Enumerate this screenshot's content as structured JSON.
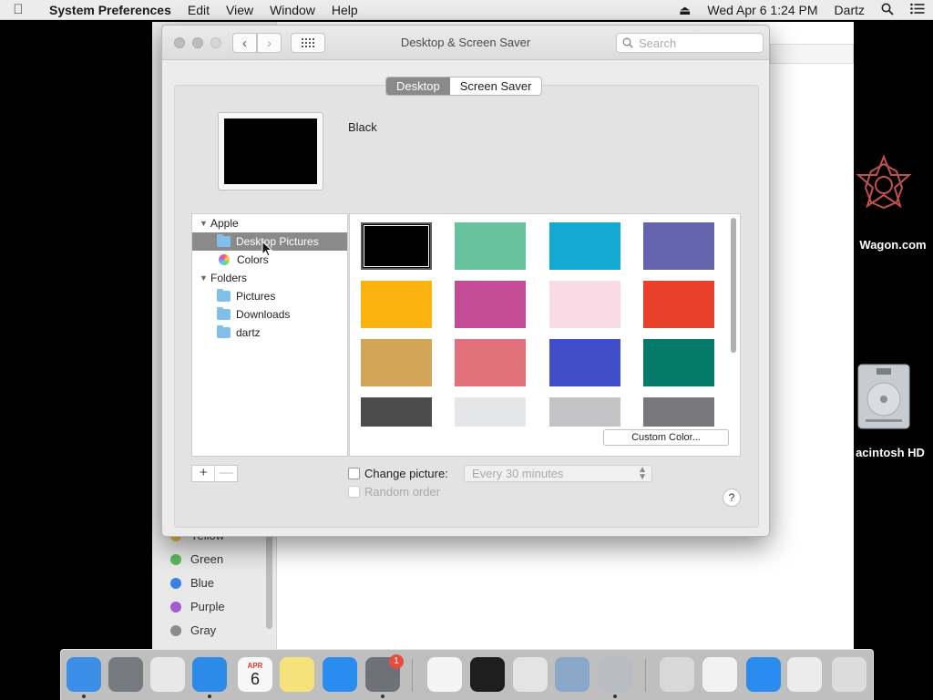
{
  "menubar": {
    "app_name": "System Preferences",
    "menus": [
      "Edit",
      "View",
      "Window",
      "Help"
    ],
    "datetime": "Wed Apr 6  1:24 PM",
    "user": "Dartz"
  },
  "background_window": {
    "tags": [
      {
        "label": "Yellow",
        "color": "#e8b83a"
      },
      {
        "label": "Green",
        "color": "#5cb85c"
      },
      {
        "label": "Blue",
        "color": "#3b82e0"
      },
      {
        "label": "Purple",
        "color": "#a55bd1"
      },
      {
        "label": "Gray",
        "color": "#8c8c8c"
      }
    ]
  },
  "desktop_icons": {
    "web_label": "Wagon.com",
    "disk_label": "acintosh HD"
  },
  "window": {
    "title": "Desktop & Screen Saver",
    "search_placeholder": "Search",
    "tabs": [
      {
        "label": "Desktop",
        "active": true
      },
      {
        "label": "Screen Saver",
        "active": false
      }
    ],
    "preview_name": "Black",
    "source_list": {
      "groups": [
        {
          "label": "Apple",
          "items": [
            {
              "label": "Desktop Pictures",
              "icon": "folder-icon",
              "selected": true
            },
            {
              "label": "Colors",
              "icon": "color-wheel-icon",
              "selected": false
            }
          ]
        },
        {
          "label": "Folders",
          "items": [
            {
              "label": "Pictures",
              "icon": "folder-icon",
              "selected": false
            },
            {
              "label": "Downloads",
              "icon": "folder-icon",
              "selected": false
            },
            {
              "label": "dartz",
              "icon": "folder-icon",
              "selected": false
            }
          ]
        }
      ]
    },
    "swatches": [
      "#000000",
      "#66c19c",
      "#13a9d1",
      "#6463ad",
      "#fbb40f",
      "#c44b96",
      "#f8dbe5",
      "#e8402a",
      "#d2a656",
      "#e1707a",
      "#3f4dc8",
      "#047a6a",
      "#4c4c4c",
      "#e4e6e8",
      "#c3c3c6",
      "#77777c"
    ],
    "selected_swatch": 0,
    "custom_color_label": "Custom Color...",
    "add_label": "+",
    "remove_label": "—",
    "change_picture_label": "Change picture:",
    "interval_value": "Every 30 minutes",
    "random_order_label": "Random order",
    "help_label": "?"
  },
  "dock": {
    "items": [
      {
        "name": "finder",
        "color": "#3a8ee6",
        "running": true
      },
      {
        "name": "launchpad",
        "color": "#777b80",
        "running": false
      },
      {
        "name": "chrome",
        "color": "#e8e8e8",
        "running": false
      },
      {
        "name": "safari",
        "color": "#2c8ae8",
        "running": true
      },
      {
        "name": "calendar",
        "color": "#f7f7f7",
        "running": false,
        "month": "APR",
        "day": "6"
      },
      {
        "name": "notes",
        "color": "#f6e27a",
        "running": false
      },
      {
        "name": "app-store",
        "color": "#2b8cf0",
        "running": false
      },
      {
        "name": "system-preferences",
        "color": "#6e7278",
        "running": true,
        "badge": "1"
      },
      {
        "name": "textedit",
        "color": "#f4f4f4",
        "running": false
      },
      {
        "name": "terminal",
        "color": "#1e1e1e",
        "running": false
      },
      {
        "name": "script-editor",
        "color": "#e4e4e4",
        "running": false
      },
      {
        "name": "preview",
        "color": "#8aa7c7",
        "running": false
      },
      {
        "name": "installer",
        "color": "#b9bcc0",
        "running": true
      },
      {
        "name": "screenshot",
        "color": "#d8d8d8",
        "running": false
      },
      {
        "name": "document",
        "color": "#f2f2f2",
        "running": false
      },
      {
        "name": "app-store-2",
        "color": "#2b8cf0",
        "running": false
      },
      {
        "name": "downloads-stack",
        "color": "#ececec",
        "running": false
      },
      {
        "name": "trash",
        "color": "#dcdcdc",
        "running": false
      }
    ]
  }
}
